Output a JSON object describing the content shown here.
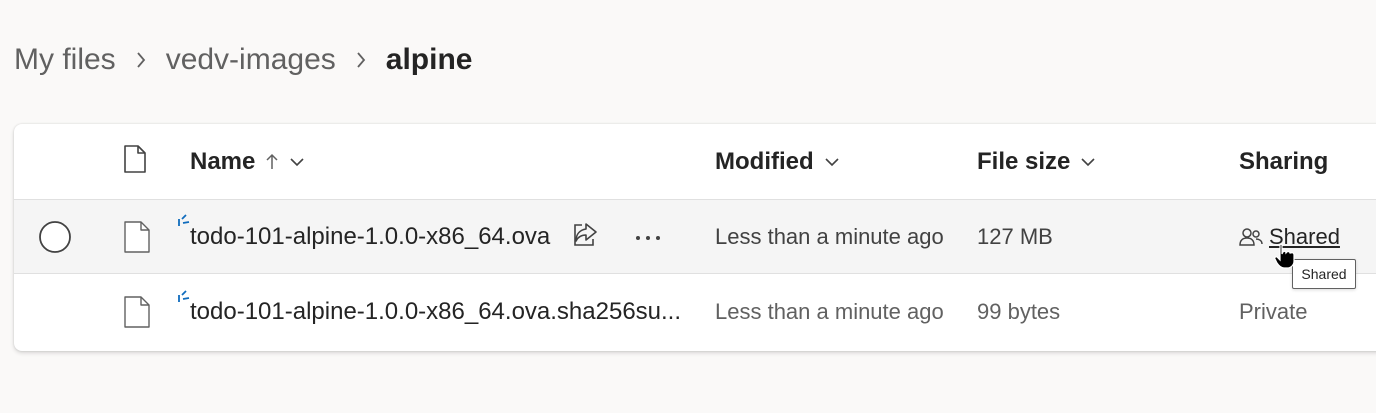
{
  "breadcrumb": {
    "items": [
      "My files",
      "vedv-images"
    ],
    "current": "alpine"
  },
  "table": {
    "columns": {
      "name": "Name",
      "modified": "Modified",
      "size": "File size",
      "sharing": "Sharing"
    },
    "sort": {
      "column": "name",
      "direction": "ascending"
    },
    "rows": [
      {
        "name": "todo-101-alpine-1.0.0-x86_64.ova",
        "modified": "Less than a minute ago",
        "size": "127 MB",
        "sharing": "Shared",
        "hovered": true,
        "is_new": true
      },
      {
        "name": "todo-101-alpine-1.0.0-x86_64.ova.sha256su...",
        "modified": "Less than a minute ago",
        "size": "99 bytes",
        "sharing": "Private",
        "is_new": true
      }
    ]
  },
  "tooltip": {
    "text": "Shared"
  },
  "colors": {
    "accent": "#0f6cbd",
    "background": "#faf9f8",
    "hover_row": "#f5f5f5"
  },
  "icons": {
    "chevron": "chevron-right-icon",
    "file_type_header": "document-icon",
    "file": "document-icon",
    "new": "new-file-sparkle-icon",
    "share": "share-icon",
    "more": "more-actions-icon",
    "people": "people-icon",
    "sort_up": "arrow-up-icon",
    "dropdown": "chevron-down-icon"
  }
}
